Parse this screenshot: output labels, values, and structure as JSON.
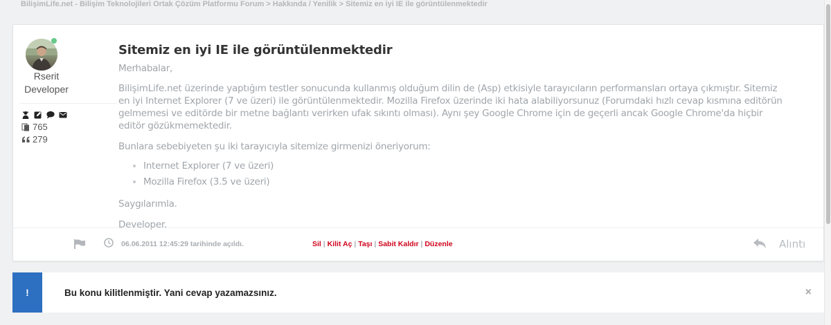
{
  "breadcrumb": {
    "items": [
      "BilişimLife.net - Bilişim Teknolojileri Ortak Çözüm Platformu Forum",
      "Hakkında / Yenilik",
      "Sitemiz en iyi IE ile görüntülenmektedir"
    ],
    "separator": " > "
  },
  "author": {
    "name": "Rserit",
    "role": "Developer",
    "status_color": "#67c98b",
    "icons": [
      "user-secret-icon",
      "edit-icon",
      "comment-icon",
      "envelope-icon"
    ],
    "stats": [
      {
        "icon": "pages-icon",
        "value": "765"
      },
      {
        "icon": "quote-left-icon",
        "value": "279"
      }
    ]
  },
  "post": {
    "title": "Sitemiz en iyi IE ile görüntülenmektedir",
    "greeting": "Merhabalar,",
    "paragraph1": "BilişimLife.net üzerinde yaptığım testler sonucunda kullanmış olduğum dilin de (Asp) etkisiyle tarayıcıların performansları ortaya çıkmıştır. Sitemiz en iyi Internet Explorer (7 ve üzeri) ile görüntülenmektedir. Mozilla Firefox üzerinde iki hata alabiliyorsunuz (Forumdaki hızlı cevap kısmına editörün gelmemesi ve editörde bir metne bağlantı verirken ufak sıkıntı olması). Aynı şey Google Chrome için de geçerli ancak Google Chrome'da hiçbir editör gözükmemektedir.",
    "paragraph2": "Bunlara sebebiyeten şu iki tarayıcıyla sitemize girmenizi öneriyorum:",
    "list": [
      "Internet Explorer (7 ve üzeri)",
      "Mozilla Firefox (3.5 ve üzeri)"
    ],
    "closing": "Saygılarımla.",
    "signature": "Developer."
  },
  "footer": {
    "date_text": "06.06.2011 12:45:29 tarihinde açıldı.",
    "actions": [
      "Sil",
      "Kilit Aç",
      "Taşı",
      "Sabit Kaldır",
      "Düzenle"
    ],
    "action_separator": " | ",
    "action_color": "#d0021b",
    "quote_label": "Alıntı"
  },
  "notice": {
    "badge": "!",
    "text": "Bu konu kilitlenmiştir. Yani cevap yazamazsınız.",
    "close": "×",
    "badge_color": "#2d6fc0"
  }
}
